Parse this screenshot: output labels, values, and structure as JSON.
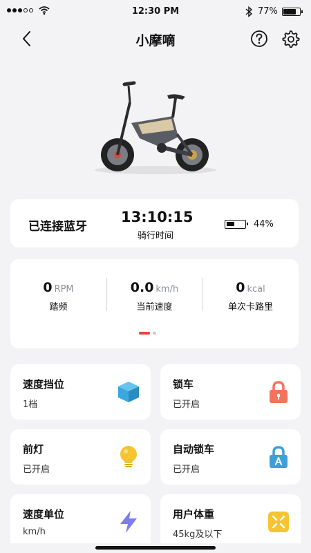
{
  "status_bar": {
    "time": "12:30 PM",
    "battery_pct": "77%",
    "signal_icon": "signal-dots-icon",
    "wifi_icon": "wifi-icon",
    "bluetooth_icon": "bluetooth-icon"
  },
  "nav": {
    "title": "小摩嘀",
    "back_icon": "back-chevron-icon",
    "help_icon": "help-circle-icon",
    "settings_icon": "gear-icon"
  },
  "status": {
    "connection": "已连接蓝牙",
    "ride_time": "13:10:15",
    "ride_time_label": "骑行时间",
    "battery_pct": "44%",
    "battery_level": 0.44
  },
  "stats": [
    {
      "value": "0",
      "unit": "RPM",
      "label": "踏频"
    },
    {
      "value": "0.0",
      "unit": "km/h",
      "label": "当前速度"
    },
    {
      "value": "0",
      "unit": "kcal",
      "label": "单次卡路里"
    }
  ],
  "tiles": [
    {
      "title": "速度挡位",
      "subtitle": "1档",
      "icon": "cube-icon",
      "color": "#3aa7de"
    },
    {
      "title": "锁车",
      "subtitle": "已开启",
      "icon": "padlock-icon",
      "color": "#f3735b"
    },
    {
      "title": "前灯",
      "subtitle": "已开启",
      "icon": "lightbulb-icon",
      "color": "#f6c431"
    },
    {
      "title": "自动锁车",
      "subtitle": "已开启",
      "icon": "auto-lock-icon",
      "color": "#3f9fd8"
    },
    {
      "title": "速度单位",
      "subtitle": "km/h",
      "icon": "lightning-icon",
      "color": "#7b7df0"
    },
    {
      "title": "用户体重",
      "subtitle": "45kg及以下",
      "icon": "scale-icon",
      "color": "#f6c431"
    }
  ]
}
